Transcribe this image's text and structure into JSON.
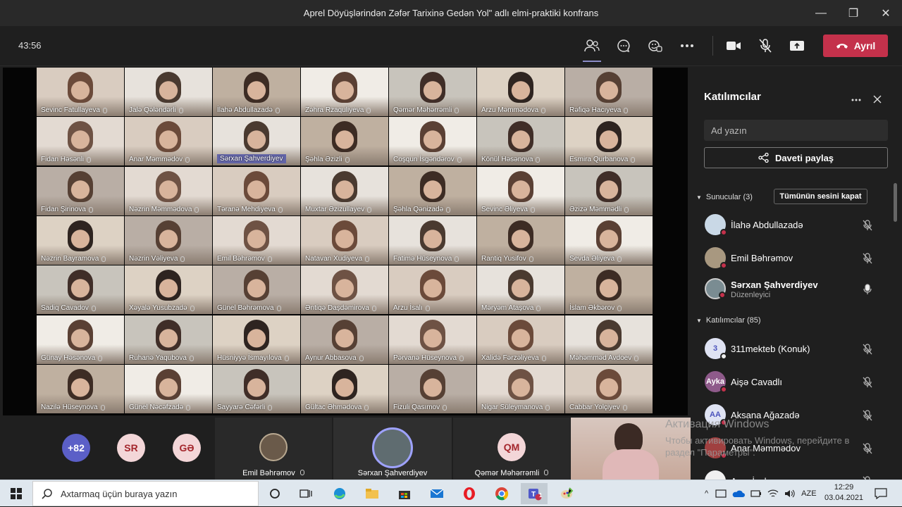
{
  "window": {
    "title": "Aprel Döyüşlərindən Zəfər Tarixinə Gedən Yol\" adlı elmi-praktiki konfrans"
  },
  "toolbar": {
    "timer": "43:56",
    "leave_label": "Ayrıl"
  },
  "grid": {
    "rows": [
      [
        "Sevinc Fatullayeva",
        "Jalə Qələndərli",
        "İlahə Abdullazadə",
        "Zəhra Rzaquliyeva",
        "Qəmər Məhərrəmli",
        "Arzu Məmmədova",
        "Rəfiqə Hacıyeva"
      ],
      [
        "Fidan Həsənli",
        "Anar Məmmədov",
        "Sərxan Şahverdiyev",
        "Şəhla Əzizli",
        "Coşqun İsgəndərov",
        "Könül Həsənova",
        "Esmira Qurbanova"
      ],
      [
        "Fidan Şirinova",
        "Nəzrin Məmmədova",
        "Təranə Mehdiyeva",
        "Muxtar Əzizullayev",
        "Şəhla Qənizadə",
        "Sevinc Əliyeva",
        "Əzizə Məmmədli"
      ],
      [
        "Nəzrin Bayramova",
        "Nəzrin Vəliyeva",
        "Emil Bəhrəmov",
        "Natavan Xudiyeva",
        "Fatimə Hüseynova",
        "Rantiq Yusifov",
        "Sevda Əliyeva"
      ],
      [
        "Sadiq Cavadov",
        "Xəyalə Yusubzadə",
        "Günel Bəhrəmova",
        "Əntiqə Daşdəmirova",
        "Arzu İsalı",
        "Məryəm Ataşova",
        "İslam Əkbərov"
      ],
      [
        "Günay Həsənova",
        "Ruhanə Yaqubova",
        "Hüsniyyə İsmayılova",
        "Aynur Abbasova",
        "Pərvanə Hüseynova",
        "Xalidə Fərzəliyeva",
        "Məhəmməd Avdoev"
      ],
      [
        "Nazilə Hüseynova",
        "Günel Nəcəfzadə",
        "Sayyarə Cəfərli",
        "Gültac Əhmədova",
        "Fizuli Qasımov",
        "Nigar Süleymanova",
        "Cabbar Yolçiyev"
      ]
    ],
    "highlighted": "Sərxan Şahverdiyev"
  },
  "bottom": {
    "more_count": "+82",
    "avatar_sr": "SR",
    "avatar_ge": "GƏ",
    "tile1_name": "Emil Bəhrəmov",
    "tile2_name": "Sərxan Şahverdiyev",
    "tile3_initials": "QM",
    "tile3_name": "Qəmər Məhərrəmli"
  },
  "panel": {
    "title": "Katılımcılar",
    "search_placeholder": "Ad yazın",
    "invite_label": "Daveti paylaş",
    "presenters_label": "Sunucular (3)",
    "mute_all_label": "Tümünün sesini kapat",
    "presenters": [
      {
        "name": "İlahə Abdullazadə",
        "sub": ""
      },
      {
        "name": "Emil Bəhrəmov",
        "sub": ""
      },
      {
        "name": "Sərxan Şahverdiyev",
        "sub": "Düzenleyici"
      }
    ],
    "attendees_label": "Katılımcılar (85)",
    "attendees": [
      {
        "initials": "3",
        "name": "311mekteb (Konuk)"
      },
      {
        "initials": "Ayka",
        "name": "Aişə Cavadlı"
      },
      {
        "initials": "AA",
        "name": "Aksana Ağazadə"
      },
      {
        "initials": "",
        "name": "Anar Məmmədov"
      },
      {
        "initials": "",
        "name": "Arzu İsalı"
      }
    ]
  },
  "activation": {
    "line1": "Активация Windows",
    "line2": "Чтобы активировать Windows, перейдите в",
    "line3": "раздел \"Параметры\"."
  },
  "taskbar": {
    "search_placeholder": "Axtarmaq üçün buraya yazın",
    "lang": "AZE",
    "time": "12:29",
    "date": "03.04.2021",
    "teams_badge": "1"
  }
}
